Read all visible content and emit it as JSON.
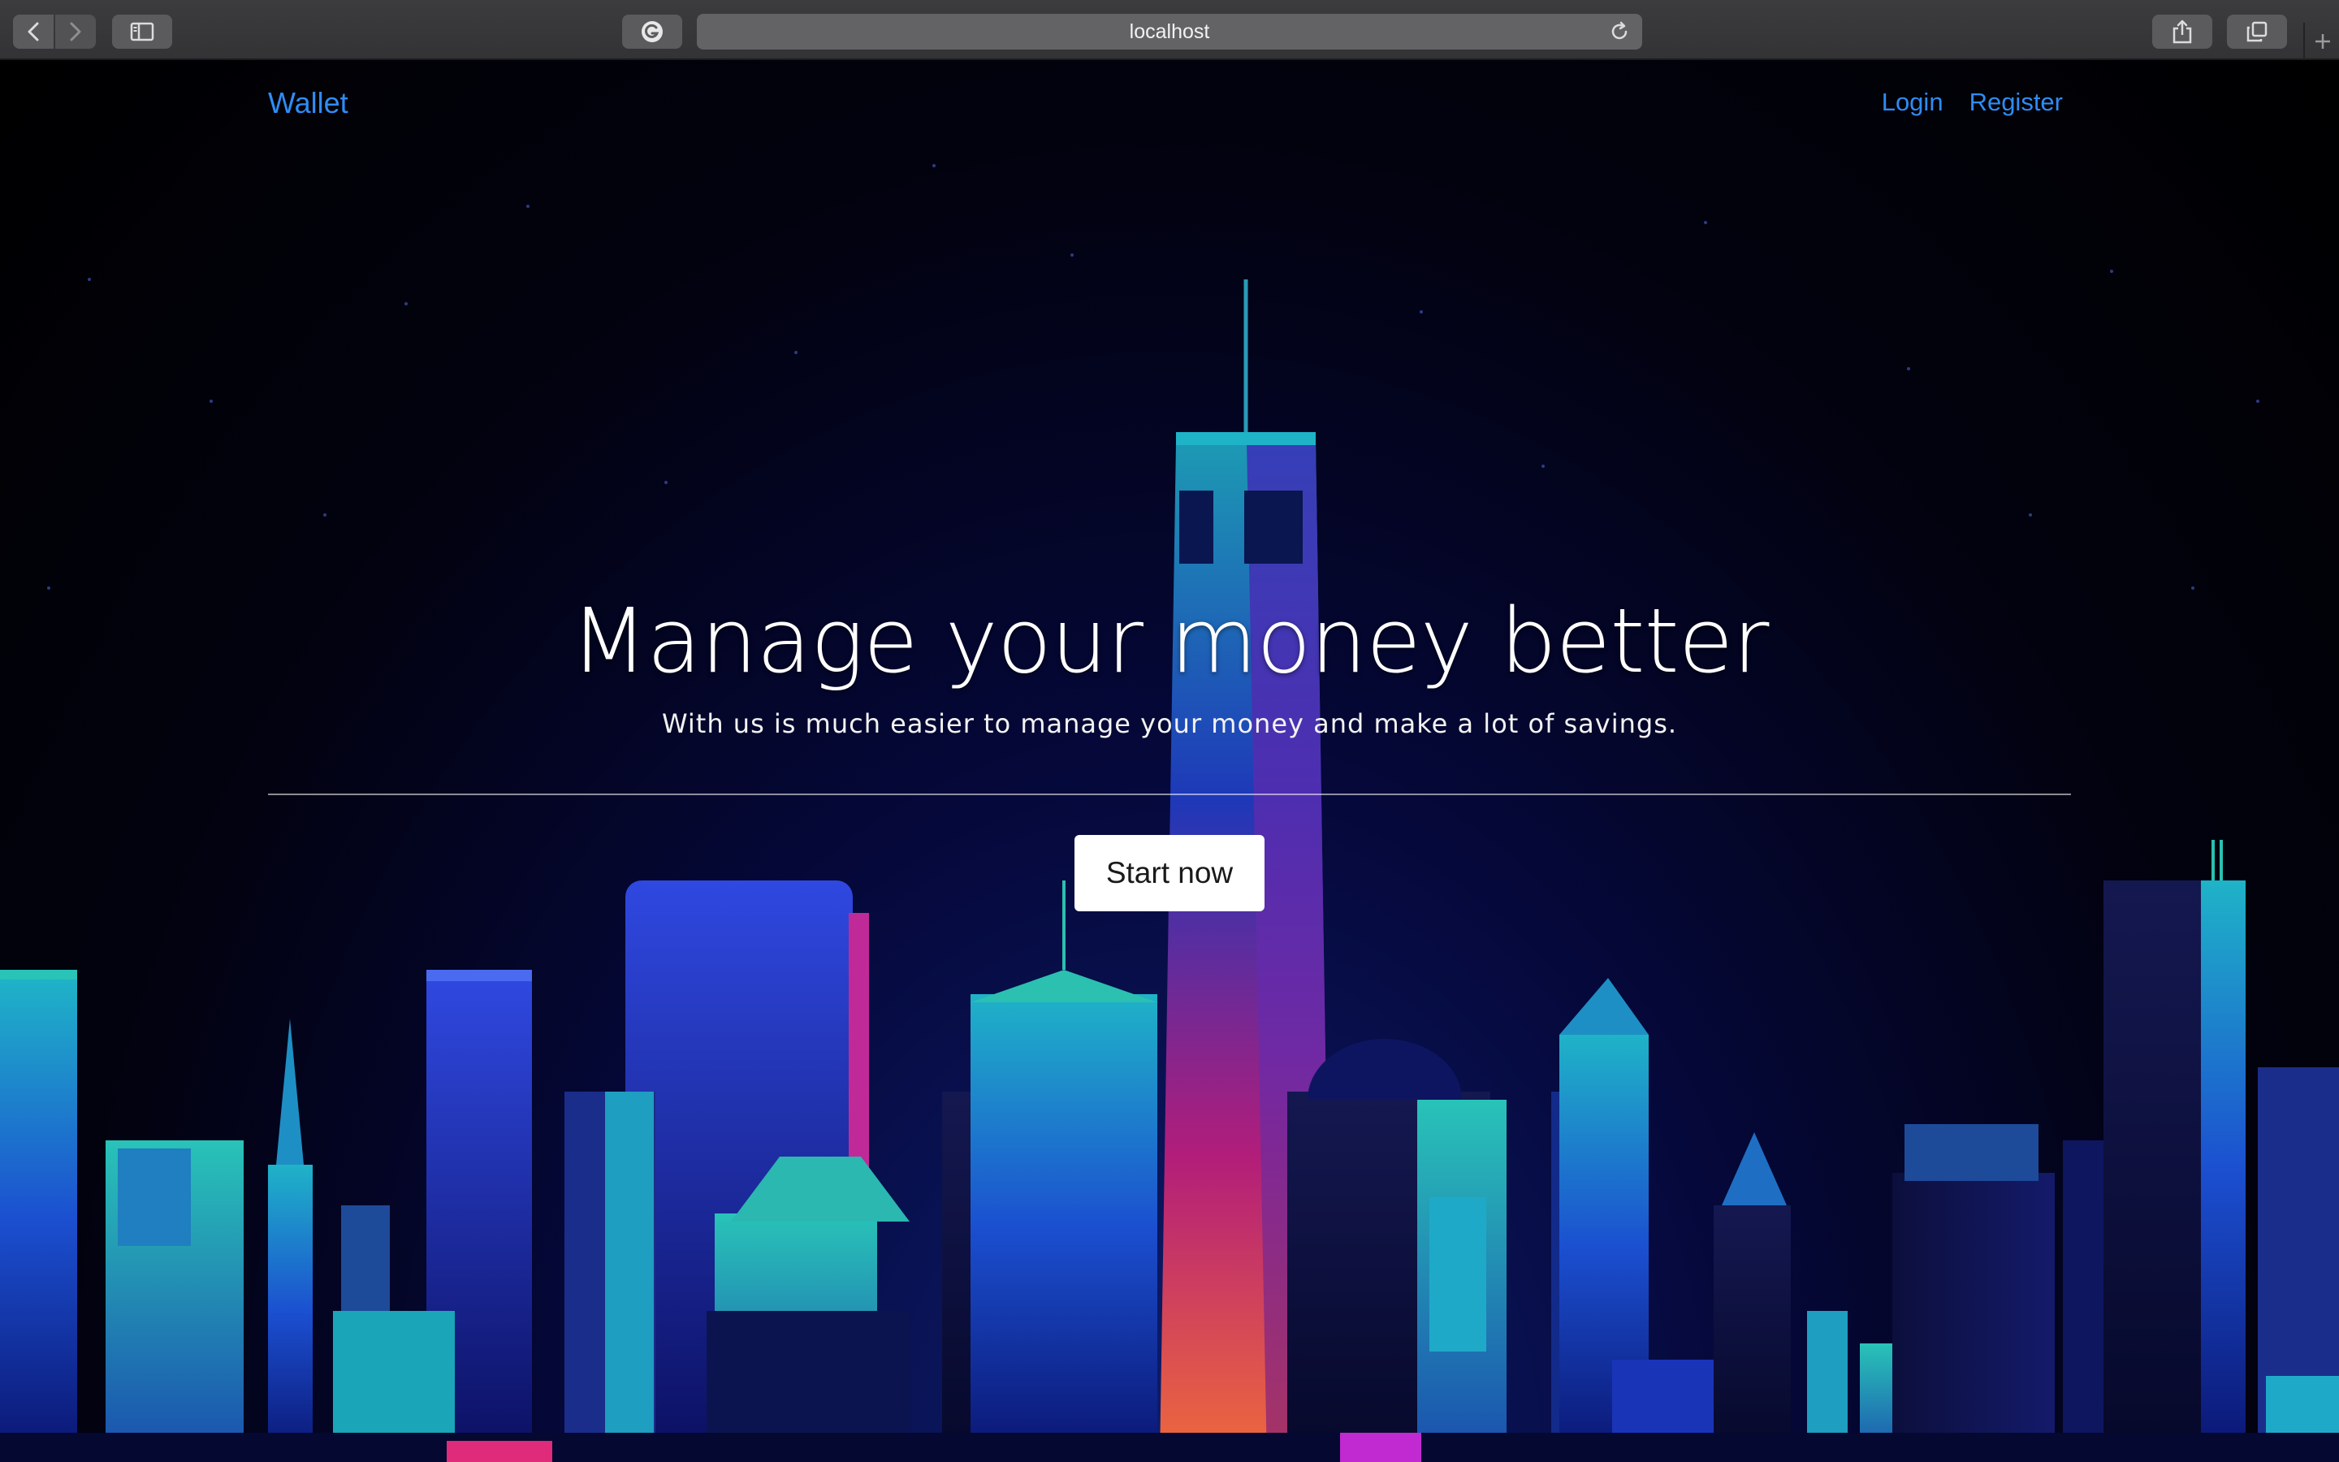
{
  "browser": {
    "url": "localhost",
    "icons": {
      "back": "chevron-left-icon",
      "forward": "chevron-right-icon",
      "sidebar": "sidebar-icon",
      "extension": "grammarly-icon",
      "reload": "reload-icon",
      "share": "share-icon",
      "tabs": "tabs-overview-icon",
      "new_tab": "plus-icon"
    }
  },
  "navbar": {
    "brand": "Wallet",
    "links": [
      "Login",
      "Register"
    ]
  },
  "hero": {
    "title": "Manage your money better",
    "subtitle": "With us is much easier to manage your money and make a lot of savings.",
    "cta": "Start now"
  },
  "colors": {
    "link": "#2f8cf4",
    "chrome": "#3a3a3c",
    "background": "#000000",
    "button": "#ffffff"
  }
}
